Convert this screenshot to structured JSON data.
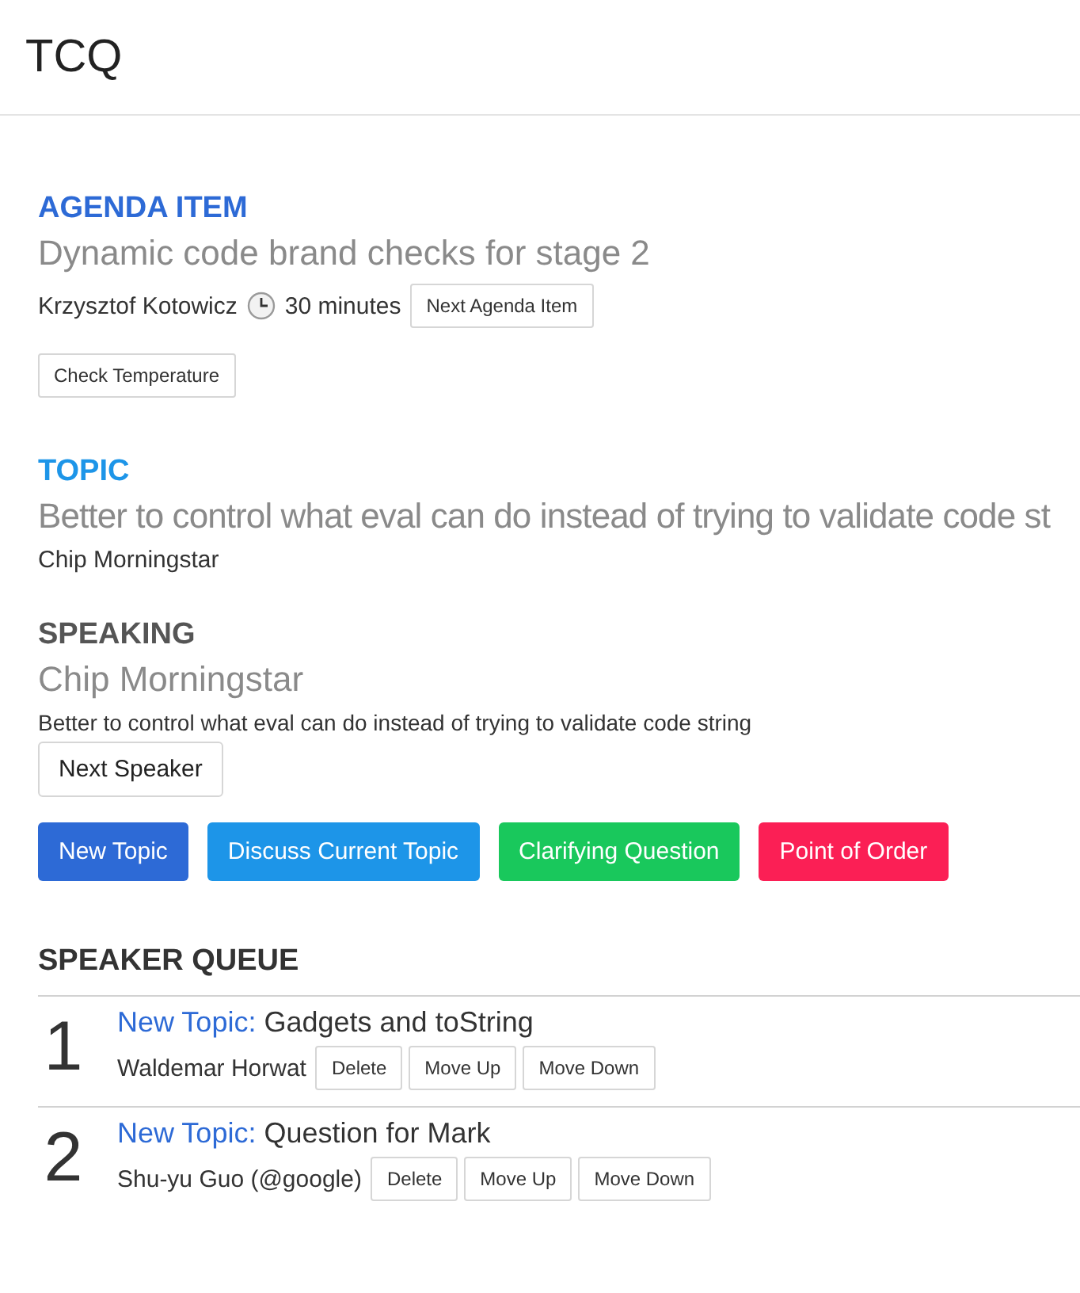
{
  "header": {
    "title": "TCQ"
  },
  "agenda_item": {
    "heading": "AGENDA ITEM",
    "title": "Dynamic code brand checks for stage 2",
    "owner": "Krzysztof Kotowicz",
    "timebox": "30 minutes",
    "next_button": "Next Agenda Item",
    "temperature_button": "Check Temperature"
  },
  "topic": {
    "heading": "TOPIC",
    "title": "Better to control what eval can do instead of trying to validate code st",
    "speaker": "Chip Morningstar"
  },
  "speaking": {
    "heading": "SPEAKING",
    "speaker": "Chip Morningstar",
    "topic": "Better to control what eval can do instead of trying to validate code string",
    "next_button": "Next Speaker"
  },
  "queue_buttons": [
    {
      "label": "New Topic",
      "kind": "topic"
    },
    {
      "label": "Discuss Current Topic",
      "kind": "reply"
    },
    {
      "label": "Clarifying Question",
      "kind": "question"
    },
    {
      "label": "Point of Order",
      "kind": "point"
    }
  ],
  "speaker_queue": {
    "heading": "SPEAKER QUEUE",
    "entries": [
      {
        "number": "1",
        "type": "New Topic:",
        "kind": "topic",
        "topic": "Gadgets and toString",
        "speaker": "Waldemar Horwat",
        "actions": [
          "Delete",
          "Move Up",
          "Move Down"
        ]
      },
      {
        "number": "2",
        "type": "New Topic:",
        "kind": "topic",
        "topic": "Question for Mark",
        "speaker": "Shu-yu Guo (@google)",
        "actions": [
          "Delete",
          "Move Up",
          "Move Down"
        ]
      }
    ]
  }
}
